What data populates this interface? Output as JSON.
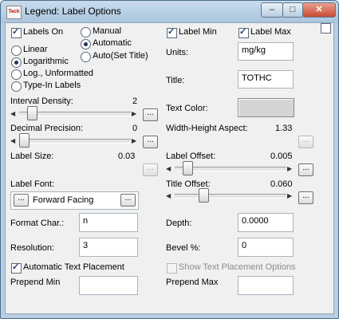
{
  "window": {
    "title": "Legend: Label Options",
    "icon_text": "Tech",
    "minimize_glyph": "–",
    "maximize_glyph": "□",
    "close_glyph": "✕"
  },
  "labels_on": {
    "label": "Labels On",
    "checked": true
  },
  "scale": {
    "options": [
      "Linear",
      "Logarithmic",
      "Log., Unformatted",
      "Type-In Labels"
    ],
    "selected": "Logarithmic"
  },
  "mode": {
    "options": [
      "Manual",
      "Automatic",
      "Auto(Set Title)"
    ],
    "selected": "Automatic"
  },
  "label_min": {
    "label": "Label Min",
    "checked": true
  },
  "label_max": {
    "label": "Label Max",
    "checked": true
  },
  "units": {
    "label": "Units:",
    "value": "mg/kg"
  },
  "title_field": {
    "label": "Title:",
    "value": "TOTHC"
  },
  "text_color": {
    "label": "Text Color:"
  },
  "interval_density": {
    "label": "Interval Density:",
    "value": "2",
    "level": 0.15
  },
  "decimal_precision": {
    "label": "Decimal Precision:",
    "value": "0",
    "level": 0.0
  },
  "width_height": {
    "label": "Width-Height Aspect:",
    "value": "1.33"
  },
  "label_size": {
    "label": "Label Size:",
    "value": "0.03"
  },
  "label_offset": {
    "label": "Label Offset:",
    "value": "0.005",
    "level": 0.05
  },
  "label_font": {
    "label": "Label Font:",
    "value": "Forward Facing"
  },
  "title_offset": {
    "label": "Title Offset:",
    "value": "0.060",
    "level": 0.18
  },
  "format_char": {
    "label": "Format Char.:",
    "value": "n"
  },
  "depth": {
    "label": "Depth:",
    "value": "0.0000"
  },
  "resolution": {
    "label": "Resolution:",
    "value": "3"
  },
  "bevel": {
    "label": "Bevel %:",
    "value": "0"
  },
  "auto_text_placement": {
    "label": "Automatic Text Placement",
    "checked": true
  },
  "show_placement_options": {
    "label": "Show Text Placement Options",
    "checked": false,
    "enabled": false
  },
  "prepend_min": {
    "label": "Prepend Min",
    "value": ""
  },
  "prepend_max": {
    "label": "Prepend Max",
    "value": ""
  },
  "ellipsis": "...",
  "left_arrow": "◀",
  "right_arrow": "▶"
}
